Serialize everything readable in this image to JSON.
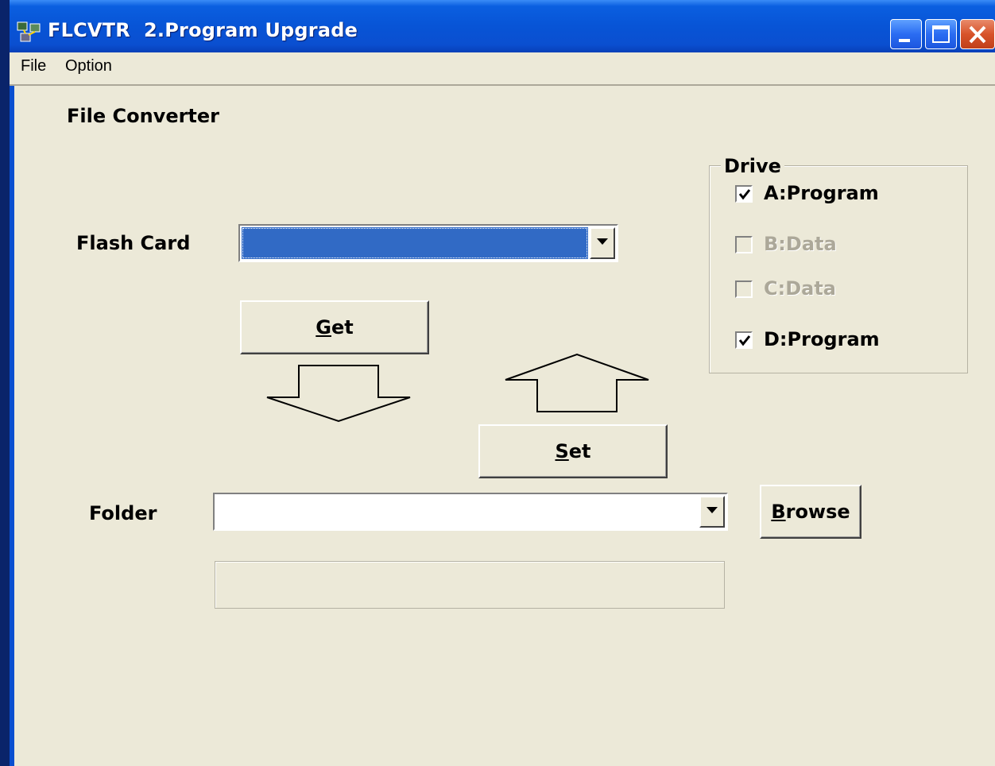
{
  "window": {
    "title": "FLCVTR  2.Program Upgrade",
    "icon": "app-network-icon"
  },
  "menu": {
    "items": [
      "File",
      "Option"
    ]
  },
  "main": {
    "section_title": "File Converter",
    "flash_card_label": "Flash Card",
    "flash_card_value": "",
    "get_button": {
      "underline": "G",
      "rest": "et"
    },
    "set_button": {
      "underline": "S",
      "rest": "et"
    },
    "folder_label": "Folder",
    "folder_value": "",
    "browse_button": {
      "underline": "B",
      "rest": "rowse"
    },
    "status_text": ""
  },
  "drive": {
    "legend": "Drive",
    "options": [
      {
        "label": "A:Program",
        "checked": true,
        "enabled": true
      },
      {
        "label": "B:Data",
        "checked": false,
        "enabled": false
      },
      {
        "label": "C:Data",
        "checked": false,
        "enabled": false
      },
      {
        "label": "D:Program",
        "checked": true,
        "enabled": true
      }
    ]
  },
  "colors": {
    "titlebar": "#0854d6",
    "selection": "#316ac5",
    "window_bg": "#ece9d8"
  }
}
